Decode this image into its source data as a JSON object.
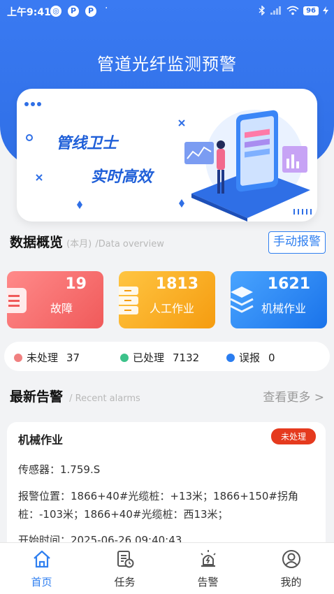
{
  "status_bar": {
    "time": "上午9:41",
    "battery": "96",
    "dot": "·"
  },
  "app": {
    "title": "管道光纤监测预警"
  },
  "banner": {
    "line1": "管线卫士",
    "line2": "实时高效"
  },
  "overview": {
    "title": "数据概览",
    "period": "(本月)",
    "subtitle": "/Data overview",
    "manual_alarm_label": "手动报警",
    "cards": [
      {
        "value": "19",
        "label": "故障",
        "color": "#f05a5a"
      },
      {
        "value": "1813",
        "label": "人工作业",
        "color": "#f59c10"
      },
      {
        "value": "1621",
        "label": "机械作业",
        "color": "#1a73ea"
      }
    ]
  },
  "status_legend": [
    {
      "label": "未处理",
      "count": "37",
      "color": "#f08080"
    },
    {
      "label": "已处理",
      "count": "7132",
      "color": "#3cc28a"
    },
    {
      "label": "误报",
      "count": "0",
      "color": "#2a7df0"
    }
  ],
  "alarms": {
    "title": "最新告警",
    "subtitle": "/ Recent alarms",
    "more_label": "查看更多 >",
    "items": [
      {
        "type": "机械作业",
        "status": "未处理",
        "sensor": "传感器：1.759.S",
        "location": "报警位置：1866+40#光缆桩：+13米；1866+150#拐角桩：-103米；1866+40#光缆桩：西13米；",
        "start_time": "开始时间：2025-06-26 09:40:43"
      }
    ]
  },
  "tabbar": [
    {
      "label": "首页",
      "icon": "home-icon",
      "active": true
    },
    {
      "label": "任务",
      "icon": "task-icon",
      "active": false
    },
    {
      "label": "告警",
      "icon": "alarm-light-icon",
      "active": false
    },
    {
      "label": "我的",
      "icon": "user-icon",
      "active": false
    }
  ],
  "colors": {
    "primary": "#2f6fe6",
    "accent": "#2f7ff0",
    "danger": "#e53a1e"
  }
}
